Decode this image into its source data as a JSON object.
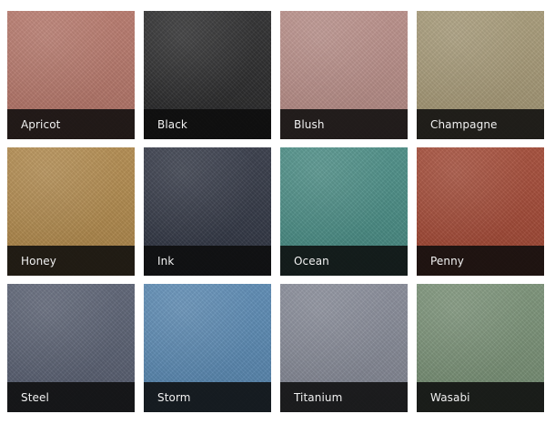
{
  "swatches": [
    {
      "label": "Apricot",
      "color": "#b8786b"
    },
    {
      "label": "Black",
      "color": "#2b2b2c"
    },
    {
      "label": "Blush",
      "color": "#ba8f89"
    },
    {
      "label": "Champagne",
      "color": "#a89b78"
    },
    {
      "label": "Honey",
      "color": "#b38b4d"
    },
    {
      "label": "Ink",
      "color": "#333846"
    },
    {
      "label": "Ocean",
      "color": "#4a8e86"
    },
    {
      "label": "Penny",
      "color": "#a54a36"
    },
    {
      "label": "Steel",
      "color": "#5a6173"
    },
    {
      "label": "Storm",
      "color": "#5a8ab4"
    },
    {
      "label": "Titanium",
      "color": "#878b98"
    },
    {
      "label": "Wasabi",
      "color": "#7a9277"
    }
  ]
}
